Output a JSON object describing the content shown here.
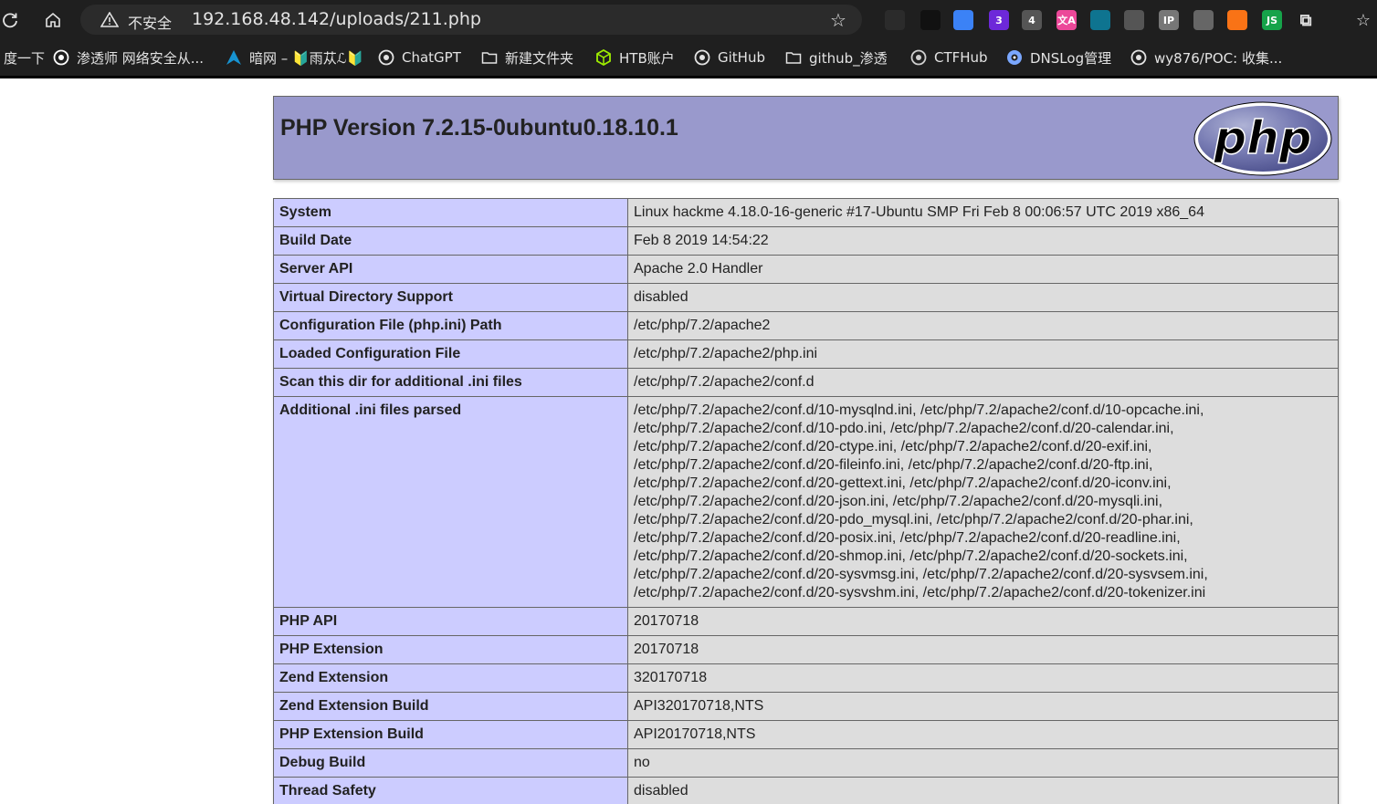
{
  "browser": {
    "security_label": "不安全",
    "url": "192.168.48.142/uploads/211.php",
    "extensions": [
      {
        "icon": "extension-icon-1",
        "color": "#2b2b2b",
        "text": ""
      },
      {
        "icon": "extension-icon-2",
        "color": "#111111",
        "text": ""
      },
      {
        "icon": "extension-icon-3",
        "color": "#3b82f6",
        "text": ""
      },
      {
        "icon": "extension-icon-4",
        "color": "#6d28d9",
        "text": "3"
      },
      {
        "icon": "extension-icon-5",
        "color": "#555555",
        "text": "4"
      },
      {
        "icon": "extension-icon-6",
        "color": "#ec4899",
        "text": "文A"
      },
      {
        "icon": "extension-icon-7",
        "color": "#0e7490",
        "text": ""
      },
      {
        "icon": "extension-icon-8",
        "color": "#555555",
        "text": ""
      },
      {
        "icon": "extension-icon-9",
        "color": "#777777",
        "text": "IP"
      },
      {
        "icon": "extension-icon-10",
        "color": "#666666",
        "text": ""
      },
      {
        "icon": "extension-icon-11",
        "color": "#f97316",
        "text": ""
      },
      {
        "icon": "extension-icon-12",
        "color": "#16a34a",
        "text": "JS"
      }
    ],
    "bookmarks": [
      {
        "label": "度一下",
        "icon": "paw-icon"
      },
      {
        "label": "渗透师 网络安全从...",
        "icon": "skull-icon"
      },
      {
        "label": "暗网 – 🔰雨苁ℒ🔰",
        "icon": "arch-icon"
      },
      {
        "label": "ChatGPT",
        "icon": "openai-icon"
      },
      {
        "label": "新建文件夹",
        "icon": "folder-icon"
      },
      {
        "label": "HTB账户",
        "icon": "htb-icon"
      },
      {
        "label": "GitHub",
        "icon": "github-icon"
      },
      {
        "label": "github_渗透",
        "icon": "folder-icon"
      },
      {
        "label": "CTFHub",
        "icon": "ctfhub-icon"
      },
      {
        "label": "DNSLog管理",
        "icon": "eye-icon"
      },
      {
        "label": "wy876/POC: 收集...",
        "icon": "github-icon"
      }
    ]
  },
  "phpinfo": {
    "title": "PHP Version 7.2.15-0ubuntu0.18.10.1",
    "logo_text": "php",
    "rows": [
      {
        "key": "System",
        "value": [
          "Linux hackme 4.18.0-16-generic #17-Ubuntu SMP Fri Feb 8 00:06:57 UTC 2019 x86_64"
        ]
      },
      {
        "key": "Build Date",
        "value": [
          "Feb 8 2019 14:54:22"
        ]
      },
      {
        "key": "Server API",
        "value": [
          "Apache 2.0 Handler"
        ]
      },
      {
        "key": "Virtual Directory Support",
        "value": [
          "disabled"
        ]
      },
      {
        "key": "Configuration File (php.ini) Path",
        "value": [
          "/etc/php/7.2/apache2"
        ]
      },
      {
        "key": "Loaded Configuration File",
        "value": [
          "/etc/php/7.2/apache2/php.ini"
        ]
      },
      {
        "key": "Scan this dir for additional .ini files",
        "value": [
          "/etc/php/7.2/apache2/conf.d"
        ]
      },
      {
        "key": "Additional .ini files parsed",
        "value": [
          "/etc/php/7.2/apache2/conf.d/10-mysqlnd.ini, /etc/php/7.2/apache2/conf.d/10-opcache.ini,",
          "/etc/php/7.2/apache2/conf.d/10-pdo.ini, /etc/php/7.2/apache2/conf.d/20-calendar.ini,",
          "/etc/php/7.2/apache2/conf.d/20-ctype.ini, /etc/php/7.2/apache2/conf.d/20-exif.ini,",
          "/etc/php/7.2/apache2/conf.d/20-fileinfo.ini, /etc/php/7.2/apache2/conf.d/20-ftp.ini,",
          "/etc/php/7.2/apache2/conf.d/20-gettext.ini, /etc/php/7.2/apache2/conf.d/20-iconv.ini,",
          "/etc/php/7.2/apache2/conf.d/20-json.ini, /etc/php/7.2/apache2/conf.d/20-mysqli.ini,",
          "/etc/php/7.2/apache2/conf.d/20-pdo_mysql.ini, /etc/php/7.2/apache2/conf.d/20-phar.ini,",
          "/etc/php/7.2/apache2/conf.d/20-posix.ini, /etc/php/7.2/apache2/conf.d/20-readline.ini,",
          "/etc/php/7.2/apache2/conf.d/20-shmop.ini, /etc/php/7.2/apache2/conf.d/20-sockets.ini,",
          "/etc/php/7.2/apache2/conf.d/20-sysvmsg.ini, /etc/php/7.2/apache2/conf.d/20-sysvsem.ini,",
          "/etc/php/7.2/apache2/conf.d/20-sysvshm.ini, /etc/php/7.2/apache2/conf.d/20-tokenizer.ini"
        ]
      },
      {
        "key": "PHP API",
        "value": [
          "20170718"
        ]
      },
      {
        "key": "PHP Extension",
        "value": [
          "20170718"
        ]
      },
      {
        "key": "Zend Extension",
        "value": [
          "320170718"
        ]
      },
      {
        "key": "Zend Extension Build",
        "value": [
          "API320170718,NTS"
        ]
      },
      {
        "key": "PHP Extension Build",
        "value": [
          "API20170718,NTS"
        ]
      },
      {
        "key": "Debug Build",
        "value": [
          "no"
        ]
      },
      {
        "key": "Thread Safety",
        "value": [
          "disabled"
        ]
      }
    ]
  }
}
